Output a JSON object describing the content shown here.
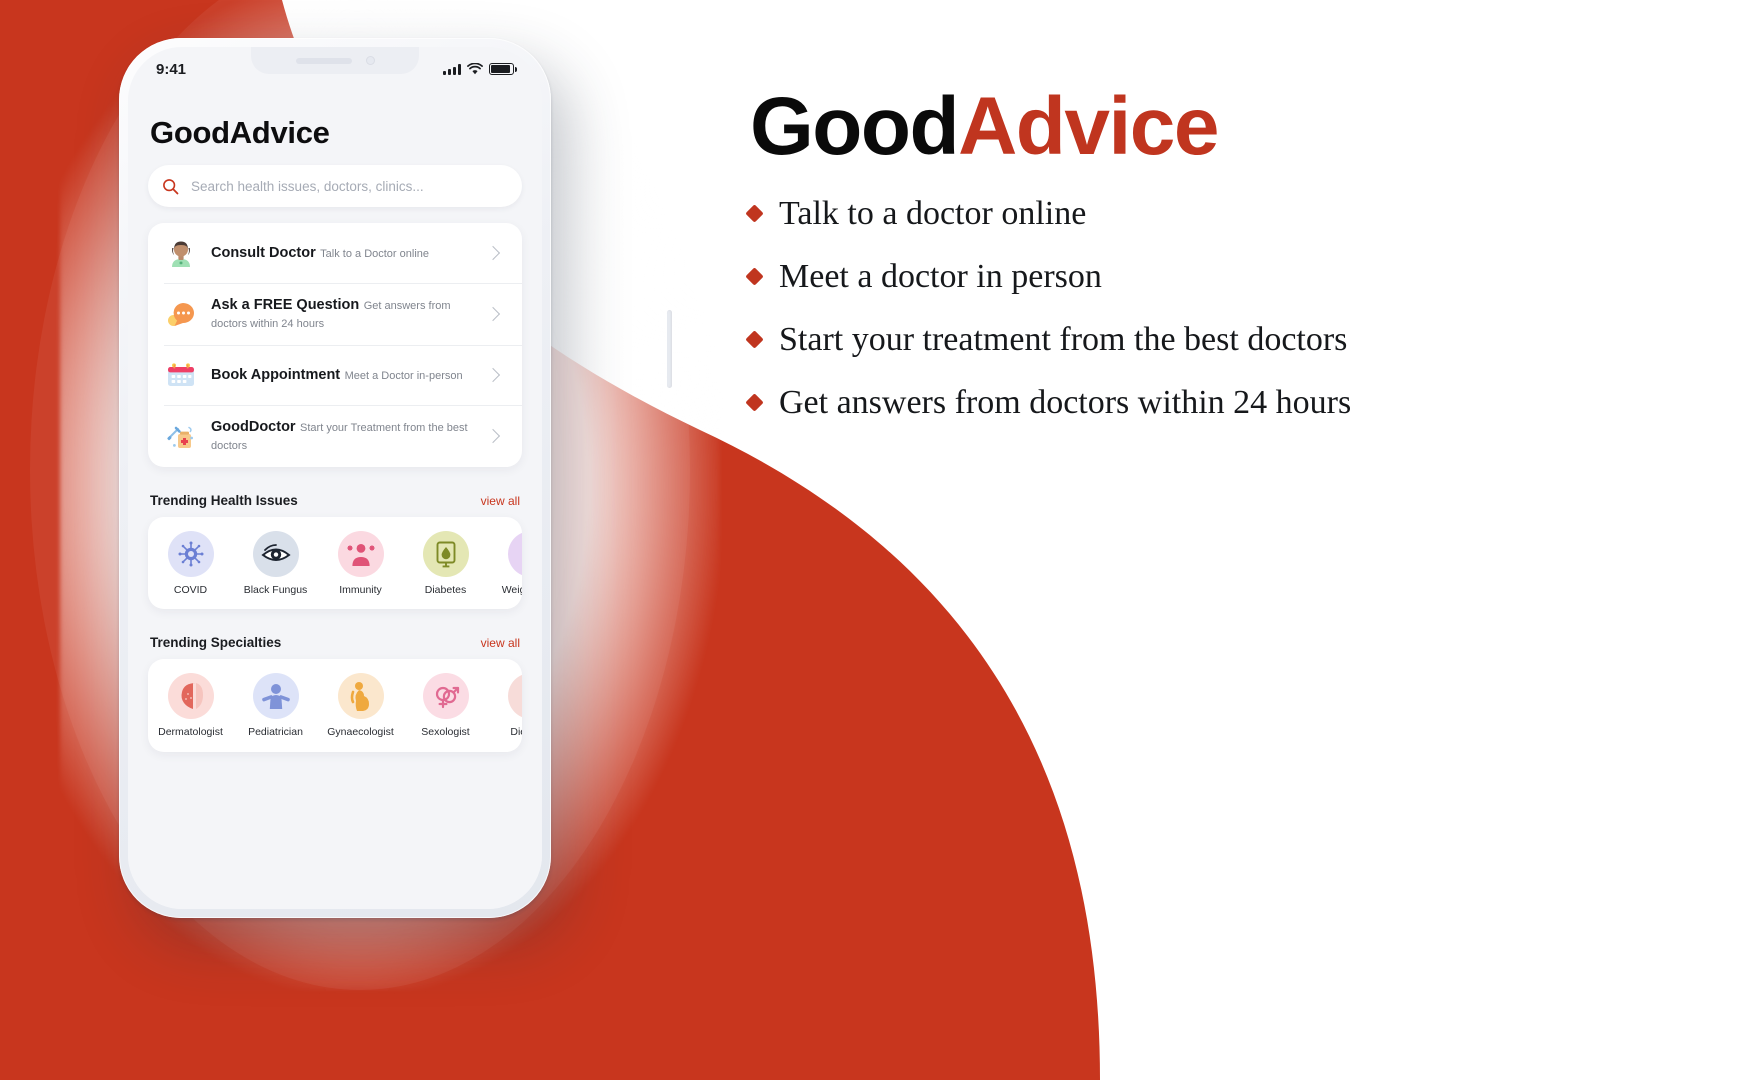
{
  "theme": {
    "brand_red": "#C8361E",
    "wordmark_red": "#C0351F",
    "text_dark": "#17191d"
  },
  "phone": {
    "status_bar": {
      "time": "9:41",
      "signal_icon": "cellular-bars-icon",
      "wifi_icon": "wifi-icon",
      "battery_icon": "battery-icon"
    },
    "app_title": "GoodAdvice",
    "search": {
      "icon": "search-icon",
      "placeholder": "Search health issues, doctors, clinics...",
      "value": ""
    },
    "menu_items": [
      {
        "icon": "doctor-avatar-icon",
        "title": "Consult Doctor",
        "subtitle": "Talk to a Doctor online",
        "chevron": "chevron-right-icon"
      },
      {
        "icon": "chat-bubble-icon",
        "title": "Ask a FREE Question",
        "subtitle": "Get answers from doctors within 24 hours",
        "chevron": "chevron-right-icon"
      },
      {
        "icon": "calendar-icon",
        "title": "Book Appointment",
        "subtitle": "Meet a Doctor in-person",
        "chevron": "chevron-right-icon"
      },
      {
        "icon": "syringe-medicine-icon",
        "title": "GoodDoctor",
        "subtitle": "Start your Treatment from the best doctors",
        "chevron": "chevron-right-icon"
      }
    ],
    "sections": [
      {
        "title": "Trending Health Issues",
        "link": "view all",
        "tiles": [
          {
            "label": "COVID",
            "icon": "virus-icon",
            "bubble": "#dfe2f7",
            "fg": "#6b7fd4"
          },
          {
            "label": "Black Fungus",
            "icon": "eye-icon",
            "bubble": "#d9e0ea",
            "fg": "#1d2430"
          },
          {
            "label": "Immunity",
            "icon": "person-shield-icon",
            "bubble": "#fbd9e1",
            "fg": "#e05377"
          },
          {
            "label": "Diabetes",
            "icon": "blood-glucose-icon",
            "bubble": "#e4e7b4",
            "fg": "#7e8a26"
          },
          {
            "label": "Weight Loss",
            "icon": "weight-loss-icon",
            "bubble": "#e7d4f4",
            "fg": "#a46fd0"
          }
        ]
      },
      {
        "title": "Trending Specialties",
        "link": "view all",
        "tiles": [
          {
            "label": "Dermatologist",
            "icon": "face-skin-icon",
            "bubble": "#fbdcd9",
            "fg": "#e2675c"
          },
          {
            "label": "Pediatrician",
            "icon": "child-icon",
            "bubble": "#dde3f8",
            "fg": "#7f93d8"
          },
          {
            "label": "Gynaecologist",
            "icon": "pregnant-woman-icon",
            "bubble": "#fbe7cd",
            "fg": "#efa93f"
          },
          {
            "label": "Sexologist",
            "icon": "gender-symbols-icon",
            "bubble": "#fbdce4",
            "fg": "#e16a92"
          },
          {
            "label": "Dietician",
            "icon": "nutrition-icon",
            "bubble": "#f7dcd9",
            "fg": "#d9604f"
          }
        ]
      }
    ]
  },
  "promo": {
    "wordmark_first": "Good",
    "wordmark_second": "Advice",
    "bullets": [
      "Talk to a doctor online",
      "Meet a doctor in  person",
      "Start your treatment from the best doctors",
      "Get answers from doctors within 24 hours"
    ]
  }
}
